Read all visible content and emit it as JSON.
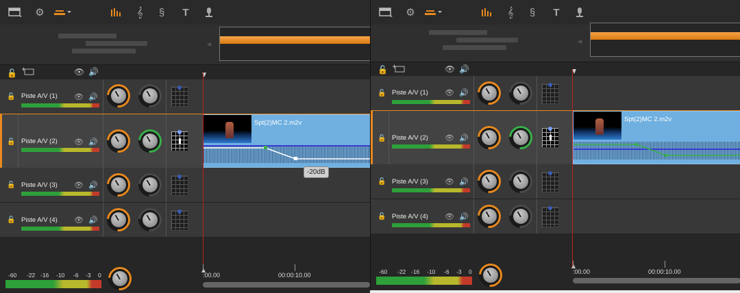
{
  "tracks": [
    {
      "name": "Piste A/V (1)"
    },
    {
      "name": "Piste A/V (2)"
    },
    {
      "name": "Piste A/V (3)"
    },
    {
      "name": "Piste A/V (4)"
    }
  ],
  "clip": {
    "name": "Spt(2)MC 2.m2v"
  },
  "volume_tag": "-20dB",
  "ruler": {
    "start": ":00.00",
    "mark": "00:00:10.00"
  },
  "master_meter": {
    "labels": [
      "-60",
      "-22",
      "-16",
      "-10",
      "-6",
      "-3",
      "0"
    ]
  },
  "colors": {
    "accent": "#e8891e",
    "playhead": "#c02020",
    "clip": "#6fb0e0",
    "green_keyframe": "#38b04a"
  },
  "icons": [
    "screen-icon",
    "gear-icon",
    "mixer-icon",
    "audio-bars-icon",
    "treble-clef-icon",
    "sound-effect-icon",
    "title-text-icon",
    "microphone-icon",
    "lock-icon",
    "eye-icon",
    "speaker-icon"
  ]
}
